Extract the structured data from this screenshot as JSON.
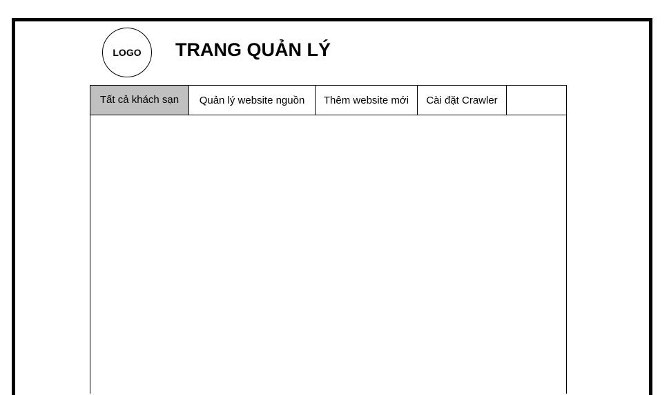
{
  "header": {
    "logo_text": "LOGO",
    "title": "TRANG QUẢN LÝ"
  },
  "tabs": [
    {
      "label": "Tất cả khách sạn",
      "active": true
    },
    {
      "label": "Quản lý website nguồn",
      "active": false
    },
    {
      "label": "Thêm website mới",
      "active": false
    },
    {
      "label": "Cài đặt Crawler",
      "active": false
    }
  ],
  "colors": {
    "active_tab": "#c0c0c0",
    "border": "#000000",
    "background": "#ffffff"
  }
}
